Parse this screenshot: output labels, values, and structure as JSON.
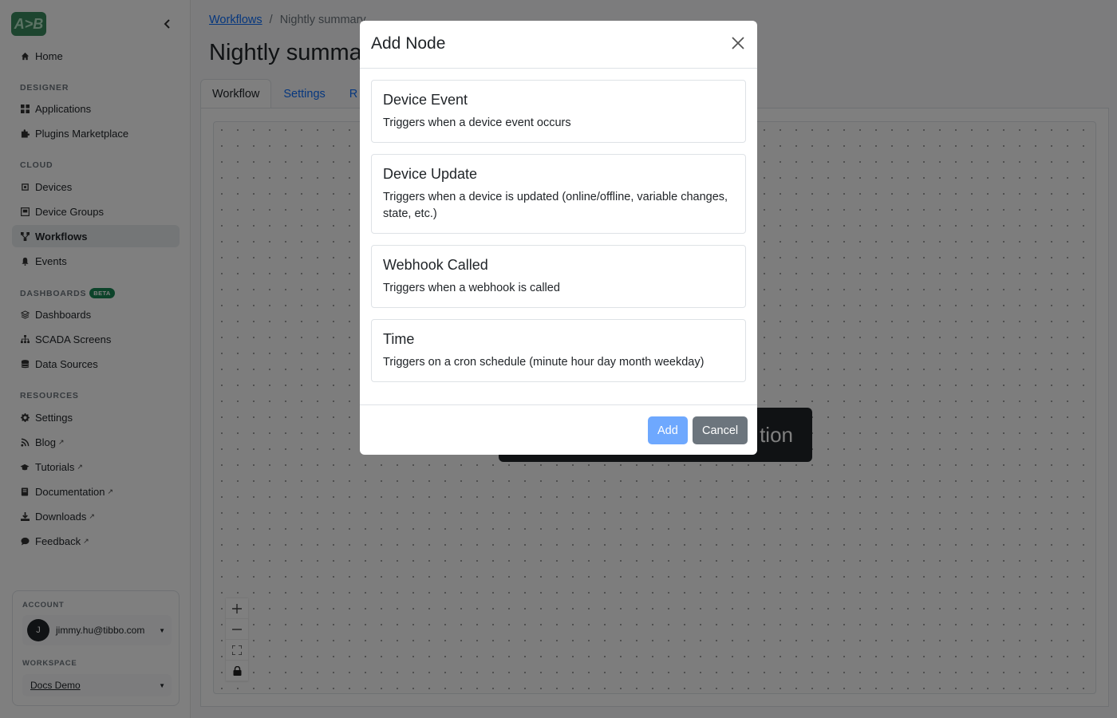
{
  "logo_text": "A>B",
  "sidebar": {
    "home": "Home",
    "sections": {
      "designer": "DESIGNER",
      "cloud": "CLOUD",
      "dashboards": "DASHBOARDS",
      "dashboards_badge": "BETA",
      "resources": "RESOURCES"
    },
    "items": {
      "applications": "Applications",
      "plugins": "Plugins Marketplace",
      "devices": "Devices",
      "device_groups": "Device Groups",
      "workflows": "Workflows",
      "events": "Events",
      "dashboards": "Dashboards",
      "scada": "SCADA Screens",
      "data_sources": "Data Sources",
      "settings": "Settings",
      "blog": "Blog",
      "tutorials": "Tutorials",
      "documentation": "Documentation",
      "downloads": "Downloads",
      "feedback": "Feedback"
    },
    "account_label": "ACCOUNT",
    "avatar_initial": "J",
    "account_email": "jimmy.hu@tibbo.com",
    "workspace_label": "WORKSPACE",
    "workspace_name": "Docs Demo"
  },
  "breadcrumb": {
    "parent": "Workflows",
    "separator": "/",
    "current": "Nightly summary"
  },
  "page_title": "Nightly summar",
  "tabs": [
    "Workflow",
    "Settings",
    "R"
  ],
  "canvas_node_text": "tion",
  "canvas_controls": [
    "+",
    "—",
    "⛶",
    "🔒"
  ],
  "modal": {
    "title": "Add Node",
    "options": [
      {
        "title": "Device Event",
        "desc": "Triggers when a device event occurs"
      },
      {
        "title": "Device Update",
        "desc": "Triggers when a device is updated (online/offline, variable changes, state, etc.)"
      },
      {
        "title": "Webhook Called",
        "desc": "Triggers when a webhook is called"
      },
      {
        "title": "Time",
        "desc": "Triggers on a cron schedule (minute hour day month weekday)"
      }
    ],
    "add_label": "Add",
    "cancel_label": "Cancel"
  },
  "colors": {
    "primary": "#0d6efd",
    "primary_disabled": "#6ea8fe",
    "secondary": "#6c757d",
    "brand": "#3a8a5e"
  }
}
